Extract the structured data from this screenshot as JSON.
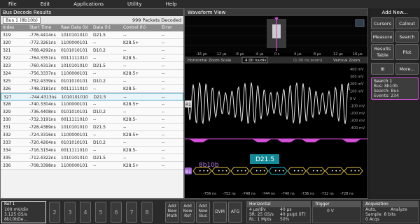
{
  "menu": [
    "File",
    "Edit",
    "Applications",
    "Utility",
    "Help"
  ],
  "bdr": {
    "title": "Bus Decode Results",
    "bus_tab": "Bus 1 (8b10b)",
    "packets": "999 Packets Decoded",
    "columns": [
      "Index",
      "Start Time",
      "Raw Data (b)",
      "Data (h)",
      "Control (h)",
      "Error"
    ],
    "rows": [
      [
        "319",
        "-776.4414ns",
        "1010101010",
        "D21.5",
        "--",
        "--"
      ],
      [
        "320",
        "-772.3261ns",
        "1100000101",
        "--",
        "K28.5+",
        "--"
      ],
      [
        "321",
        "-768.4292ns",
        "0101010101",
        "D10.2",
        "--",
        "--"
      ],
      [
        "322",
        "-764.3351ns",
        "0011111010",
        "--",
        "K28.5-",
        "--"
      ],
      [
        "323",
        "-760.4313ns",
        "1010101010",
        "D21.5",
        "--",
        "--"
      ],
      [
        "324",
        "-756.3337ns",
        "1100000101",
        "--",
        "K28.5+",
        "--"
      ],
      [
        "325",
        "-752.4339ns",
        "0101010101",
        "D10.2",
        "--",
        "--"
      ],
      [
        "326",
        "-748.3181ns",
        "0011111010",
        "--",
        "K28.5-",
        "--"
      ],
      [
        "327",
        "-744.4313ns",
        "1010101010",
        "D21.5",
        "--",
        "--"
      ],
      [
        "328",
        "-740.3304ns",
        "1100000101",
        "--",
        "K28.5+",
        "--"
      ],
      [
        "329",
        "-736.4408ns",
        "0101010101",
        "D10.2",
        "--",
        "--"
      ],
      [
        "330",
        "-732.3191ns",
        "0011111010",
        "--",
        "K28.5-",
        "--"
      ],
      [
        "331",
        "-728.4389ns",
        "1010101010",
        "D21.5",
        "--",
        "--"
      ],
      [
        "332",
        "-724.3316ns",
        "1100000101",
        "--",
        "K28.5+",
        "--"
      ],
      [
        "333",
        "-720.4264ns",
        "0101010101",
        "D10.2",
        "--",
        "--"
      ],
      [
        "334",
        "-716.3154ns",
        "0011111010",
        "--",
        "K28.5-",
        "--"
      ],
      [
        "335",
        "-712.4322ns",
        "1010101010",
        "D21.5",
        "--",
        "--"
      ],
      [
        "336",
        "-708.3398ns",
        "1100000101",
        "--",
        "K28.5+",
        "--"
      ]
    ]
  },
  "wfv": {
    "title": "Waveform View",
    "top_ticks": [
      "-16 µs",
      "-12 µs",
      "-8 µs",
      "-4 µs",
      "0 s",
      "4 µs",
      "8 µs",
      "12 µs",
      "16 µs"
    ],
    "zoom_label": "Horizontal Zoom Scale",
    "zoom_value": "4.00 ns/div",
    "zoom_pos": "(1.00 ns zoom)",
    "vzoom": "Vertical Zoom",
    "mv": [
      "400 mV",
      "300 mV",
      "200 mV",
      "100 mV",
      "0 V",
      "-100 mV",
      "-200 mV",
      "-300 mV",
      "-400 mV"
    ],
    "ch_label": "R1",
    "bus_label": "8b10b",
    "callout": "D21.5",
    "bus_badge": "B1",
    "bot_ticks": [
      "-756 ns",
      "-752 ns",
      "-748 ns",
      "-744 ns",
      "-740 ns",
      "-736 ns",
      "-732 ns",
      "-728 ns"
    ]
  },
  "right": {
    "add_new": "Add New...",
    "cursors": "Cursors",
    "callout": "Callout",
    "measure": "Measure",
    "search": "Search",
    "results": "Results Table",
    "plot": "Plot",
    "more": "More...",
    "search1": {
      "title": "Search 1",
      "l1": "Bus: 8b10b",
      "l2": "Search: Bus",
      "l3": "Events: 234"
    }
  },
  "bottom": {
    "ref": "Ref 1",
    "ref_l1": "100 mV/div",
    "ref_l2": "3.125 GS/s",
    "ref_l3": "8b10bDe...",
    "chs": [
      "2",
      "3",
      "4",
      "5",
      "6",
      "7",
      "8"
    ],
    "add_math": "Add New Math",
    "add_ref": "Add New Ref",
    "add_bus": "Add New Bus",
    "dvm": "DVM",
    "afg": "AFG",
    "horiz": {
      "title": "Horizontal",
      "a": "4 µs/div",
      "b": "40 µs",
      "c": "SR: 25 GS/s",
      "d": "40 ps/pt (IT)",
      "e": "RL: 1 Mpts",
      "f": "50%"
    },
    "trig": {
      "title": "Trigger",
      "a": "0 V"
    },
    "acq": {
      "title": "Acquisition",
      "a": "Auto,",
      "b": "Analyze",
      "c": "Sample: 8 bits",
      "d": "0 Acqs"
    }
  },
  "colors": {
    "accent": "#1fb9cc",
    "bus": "#d24fd6",
    "wave": "#e0e0e0"
  }
}
